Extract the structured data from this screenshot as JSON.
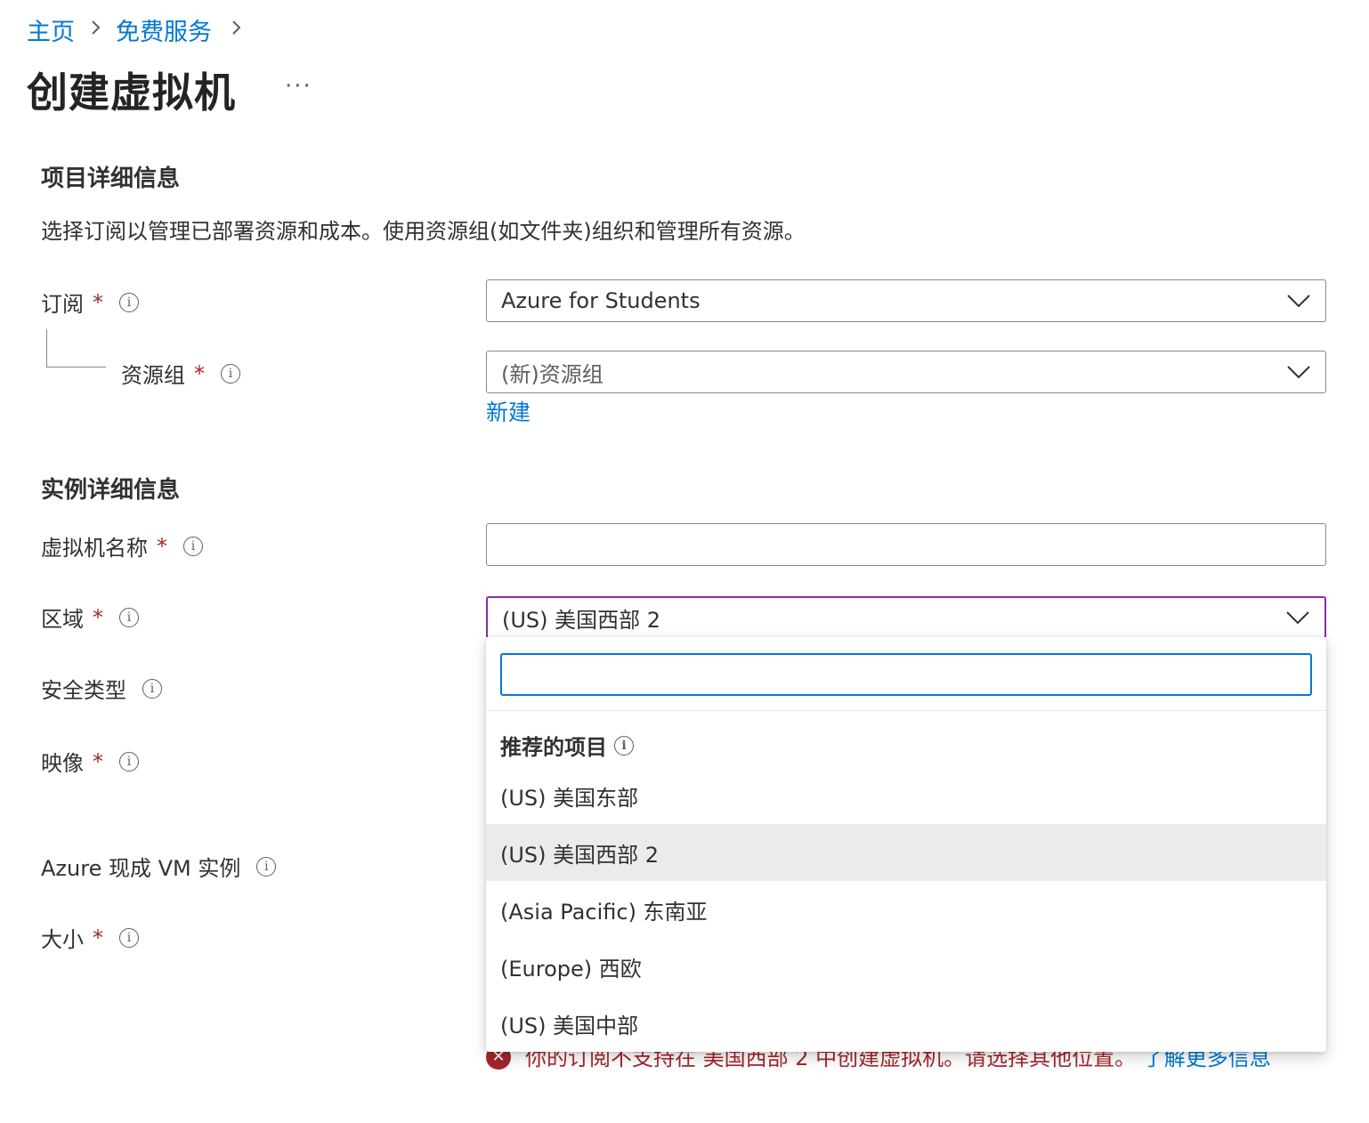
{
  "breadcrumb": {
    "home": "主页",
    "free_services": "免费服务"
  },
  "page_title": "创建虚拟机",
  "more": "···",
  "project": {
    "title": "项目详细信息",
    "description": "选择订阅以管理已部署资源和成本。使用资源组(如文件夹)组织和管理所有资源。",
    "subscription_label": "订阅",
    "subscription_value": "Azure for Students",
    "resource_group_label": "资源组",
    "resource_group_value": "(新)资源组",
    "create_new": "新建"
  },
  "instance": {
    "title": "实例详细信息",
    "vm_name_label": "虚拟机名称",
    "vm_name_value": "",
    "region_label": "区域",
    "region_value": "(US) 美国西部 2",
    "security_type_label": "安全类型",
    "image_label": "映像",
    "spot_label": "Azure 现成 VM 实例",
    "size_label": "大小"
  },
  "required_mark": "*",
  "info_glyph": "i",
  "dropdown": {
    "search_value": "",
    "group_title": "推荐的项目",
    "items": [
      {
        "label": "(US) 美国东部"
      },
      {
        "label": "(US) 美国西部 2"
      },
      {
        "label": "(Asia Pacific) 东南亚"
      },
      {
        "label": "(Europe) 西欧"
      },
      {
        "label": "(US) 美国中部"
      }
    ],
    "selected_index": 1
  },
  "error": {
    "message": "你的订阅不支持在 美国西部 2 中创建虚拟机。请选择其他位置。",
    "learn_more": "了解更多信息"
  },
  "colors": {
    "link": "#0078d4",
    "required": "#a4262c",
    "focus_border": "#8a2da5",
    "selected_bg": "#edebe9",
    "error": "#a4262c"
  }
}
